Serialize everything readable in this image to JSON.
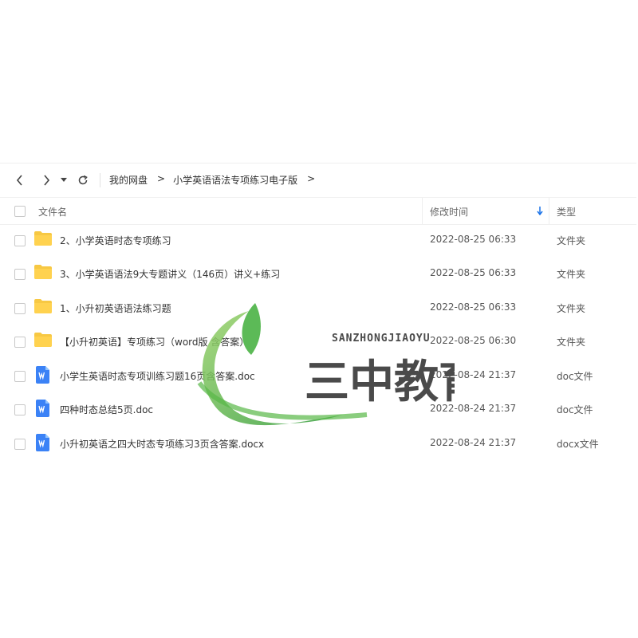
{
  "breadcrumb": {
    "root": "我的网盘",
    "current": "小学英语语法专项练习电子版",
    "separator": ">"
  },
  "columns": {
    "name": "文件名",
    "modified": "修改时间",
    "type": "类型"
  },
  "files": [
    {
      "name": "2、小学英语时态专项练习",
      "modified": "2022-08-25 06:33",
      "type": "文件夹",
      "icon": "folder-icon"
    },
    {
      "name": "3、小学英语语法9大专题讲义（146页）讲义+练习",
      "modified": "2022-08-25 06:33",
      "type": "文件夹",
      "icon": "folder-icon"
    },
    {
      "name": "1、小升初英语语法练习题",
      "modified": "2022-08-25 06:33",
      "type": "文件夹",
      "icon": "folder-icon"
    },
    {
      "name": "【小升初英语】专项练习（word版 含答案）",
      "modified": "2022-08-25 06:30",
      "type": "文件夹",
      "icon": "folder-icon"
    },
    {
      "name": "小学生英语时态专项训练习题16页含答案.doc",
      "modified": "2022-08-24 21:37",
      "type": "doc文件",
      "icon": "word-doc-icon"
    },
    {
      "name": "四种时态总结5页.doc",
      "modified": "2022-08-24 21:37",
      "type": "doc文件",
      "icon": "word-doc-icon"
    },
    {
      "name": "小升初英语之四大时态专项练习3页含答案.docx",
      "modified": "2022-08-24 21:37",
      "type": "docx文件",
      "icon": "word-doc-icon"
    }
  ],
  "watermark": {
    "pinyin": "SANZHONGJIAOYU",
    "title": "三中教育"
  },
  "colors": {
    "accent": "#1a73e8",
    "folder": "#f7c843",
    "word": "#3b82f6",
    "watermark_green": "#3fae3a",
    "watermark_text": "#4a4a4a"
  }
}
